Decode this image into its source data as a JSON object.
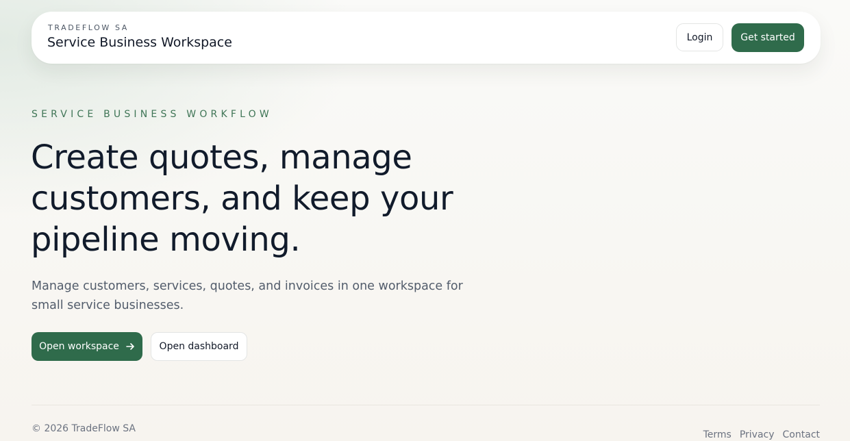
{
  "header": {
    "kicker": "TRADEFLOW SA",
    "title": "Service Business Workspace",
    "login_label": "Login",
    "get_started_label": "Get started"
  },
  "hero": {
    "eyebrow": "SERVICE BUSINESS WORKFLOW",
    "headline": "Create quotes, manage customers, and keep your pipeline moving.",
    "subtext": "Manage customers, services, quotes, and invoices in one workspace for small service businesses.",
    "primary_cta": "Open workspace",
    "primary_cta_icon": "arrow-right-icon",
    "secondary_cta": "Open dashboard"
  },
  "footer": {
    "copyright": "© 2026 TradeFlow SA",
    "links": [
      "Terms",
      "Privacy",
      "Contact"
    ]
  },
  "colors": {
    "accent": "#2f6b4b",
    "eyebrow": "#3f7556",
    "heading": "#111b2b",
    "muted": "#6b7280"
  }
}
